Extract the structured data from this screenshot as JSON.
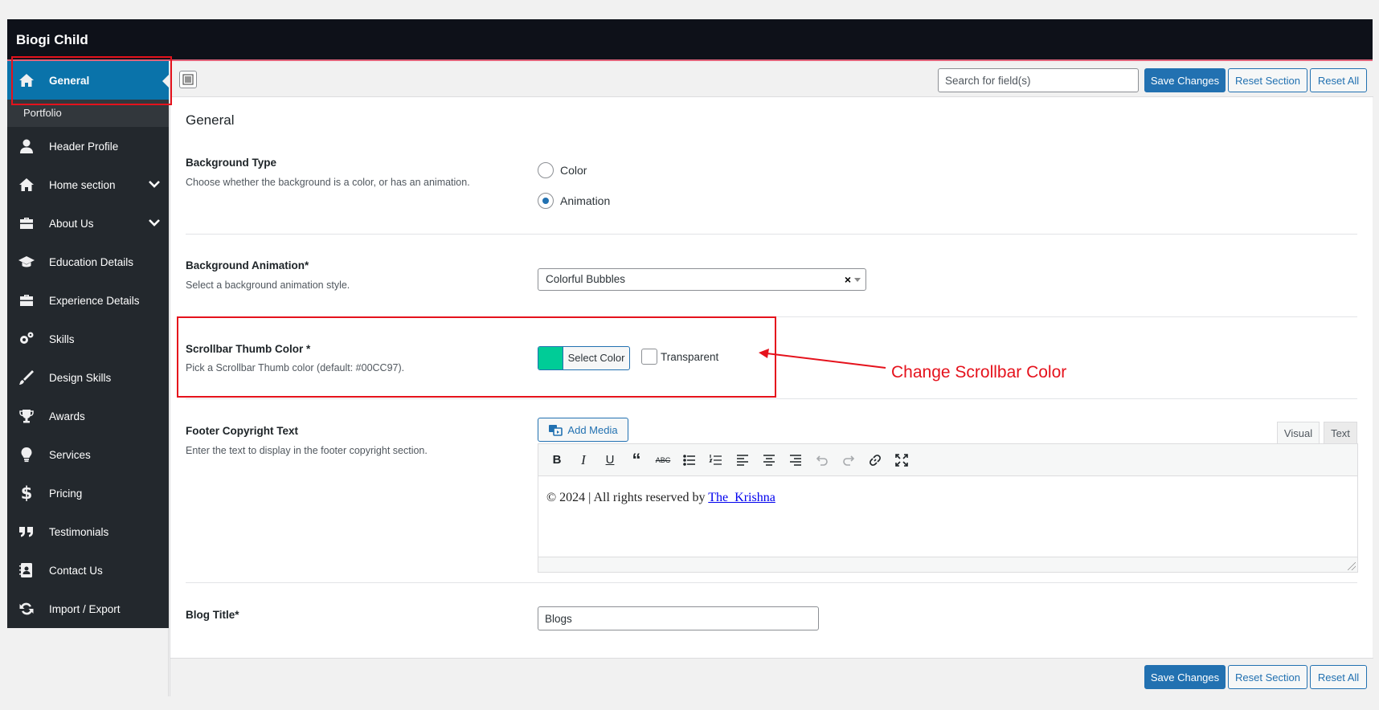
{
  "app": {
    "title": "Biogi Child"
  },
  "sidebar": {
    "items": [
      {
        "label": "General",
        "icon": "home-icon"
      },
      {
        "label": "Header Profile",
        "icon": "user-icon"
      },
      {
        "label": "Home section",
        "icon": "home-icon"
      },
      {
        "label": "About Us",
        "icon": "briefcase-icon"
      },
      {
        "label": "Education Details",
        "icon": "graduation-cap-icon"
      },
      {
        "label": "Experience Details",
        "icon": "briefcase-icon"
      },
      {
        "label": "Skills",
        "icon": "gears-icon"
      },
      {
        "label": "Design Skills",
        "icon": "brush-icon"
      },
      {
        "label": "Awards",
        "icon": "trophy-icon"
      },
      {
        "label": "Services",
        "icon": "lightbulb-icon"
      },
      {
        "label": "Pricing",
        "icon": "dollar-icon"
      },
      {
        "label": "Testimonials",
        "icon": "quote-icon"
      },
      {
        "label": "Contact Us",
        "icon": "contact-card-icon"
      },
      {
        "label": "Import / Export",
        "icon": "refresh-icon"
      }
    ],
    "sub_item": "Portfolio"
  },
  "toolbar": {
    "search_placeholder": "Search for field(s)",
    "save_label": "Save Changes",
    "reset_section_label": "Reset Section",
    "reset_all_label": "Reset All"
  },
  "section": {
    "title": "General",
    "background_type": {
      "title": "Background Type",
      "desc": "Choose whether the background is a color, or has an animation.",
      "options": [
        "Color",
        "Animation"
      ],
      "selected": "Animation"
    },
    "background_animation": {
      "title": "Background Animation*",
      "desc": "Select a background animation style.",
      "value": "Colorful Bubbles",
      "clear": "×"
    },
    "scrollbar_color": {
      "title": "Scrollbar Thumb Color *",
      "desc": "Pick a Scrollbar Thumb color (default: #00CC97).",
      "button_label": "Select Color",
      "swatch_color": "#00CC97",
      "transparent_label": "Transparent"
    },
    "footer_copyright": {
      "title": "Footer Copyright Text",
      "desc": "Enter the text to display in the footer copyright section.",
      "add_media_label": "Add Media",
      "tab_visual": "Visual",
      "tab_text": "Text",
      "content_prefix": "© 2024 | All rights reserved by ",
      "content_link": "The_Krishna"
    },
    "blog_title": {
      "title": "Blog Title*",
      "value": "Blogs"
    }
  },
  "annotation": {
    "text": "Change Scrollbar Color",
    "color": "#e5121c"
  },
  "colors": {
    "accent": "#2271b1",
    "sidebar_bg": "#23282d",
    "active_bg": "#0a73aa"
  }
}
